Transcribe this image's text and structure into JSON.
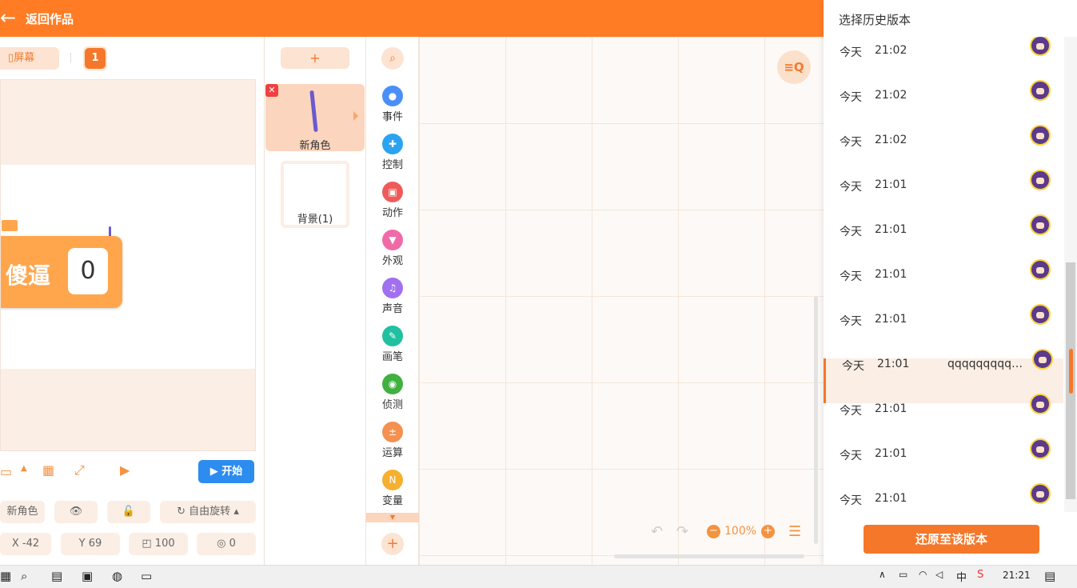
{
  "topbar": {
    "back_label": "返回作品"
  },
  "stage_panel": {
    "screen_label": "屏幕",
    "screen_number": "1",
    "monitor": {
      "label": "傻逼",
      "value": "0"
    },
    "start_label": "开始",
    "sprite_name": "新角色",
    "rotation_label": "自由旋转",
    "x_label": "X",
    "x_value": "-42",
    "y_label": "Y",
    "y_value": "69",
    "size_value": "100",
    "direction_value": "0"
  },
  "sprites": {
    "add_label": "+",
    "items": [
      {
        "name": "新角色"
      }
    ],
    "background": {
      "name": "背景(1)"
    }
  },
  "categories": [
    {
      "label": "事件",
      "color": "#4a8ff7",
      "icon": "toggle-icon"
    },
    {
      "label": "控制",
      "color": "#2ba3f0",
      "icon": "gamepad-icon"
    },
    {
      "label": "动作",
      "color": "#f05a5a",
      "icon": "robot-icon"
    },
    {
      "label": "外观",
      "color": "#f06aa8",
      "icon": "shirt-icon"
    },
    {
      "label": "声音",
      "color": "#a070f0",
      "icon": "music-icon"
    },
    {
      "label": "画笔",
      "color": "#20c0a0",
      "icon": "pen-icon"
    },
    {
      "label": "侦测",
      "color": "#40b040",
      "icon": "target-icon"
    },
    {
      "label": "运算",
      "color": "#f59050",
      "icon": "calc-icon"
    },
    {
      "label": "变量",
      "color": "#f5b030",
      "icon": "variable-icon"
    }
  ],
  "workspace": {
    "zoom": "100%"
  },
  "history": {
    "title": "选择历史版本",
    "restore_label": "还原至该版本",
    "rows": [
      {
        "day": "今天",
        "time": "21:02",
        "note": ""
      },
      {
        "day": "今天",
        "time": "21:02",
        "note": ""
      },
      {
        "day": "今天",
        "time": "21:02",
        "note": ""
      },
      {
        "day": "今天",
        "time": "21:01",
        "note": ""
      },
      {
        "day": "今天",
        "time": "21:01",
        "note": ""
      },
      {
        "day": "今天",
        "time": "21:01",
        "note": ""
      },
      {
        "day": "今天",
        "time": "21:01",
        "note": ""
      },
      {
        "day": "今天",
        "time": "21:01",
        "note": "qqqqqqqqq…",
        "selected": true
      },
      {
        "day": "今天",
        "time": "21:01",
        "note": ""
      },
      {
        "day": "今天",
        "time": "21:01",
        "note": ""
      },
      {
        "day": "今天",
        "time": "21:01",
        "note": ""
      }
    ]
  },
  "taskbar": {
    "ime": "中",
    "clock": "21:21"
  },
  "colors": {
    "brand": "#ff7c24",
    "start": "#2d8cf0"
  }
}
